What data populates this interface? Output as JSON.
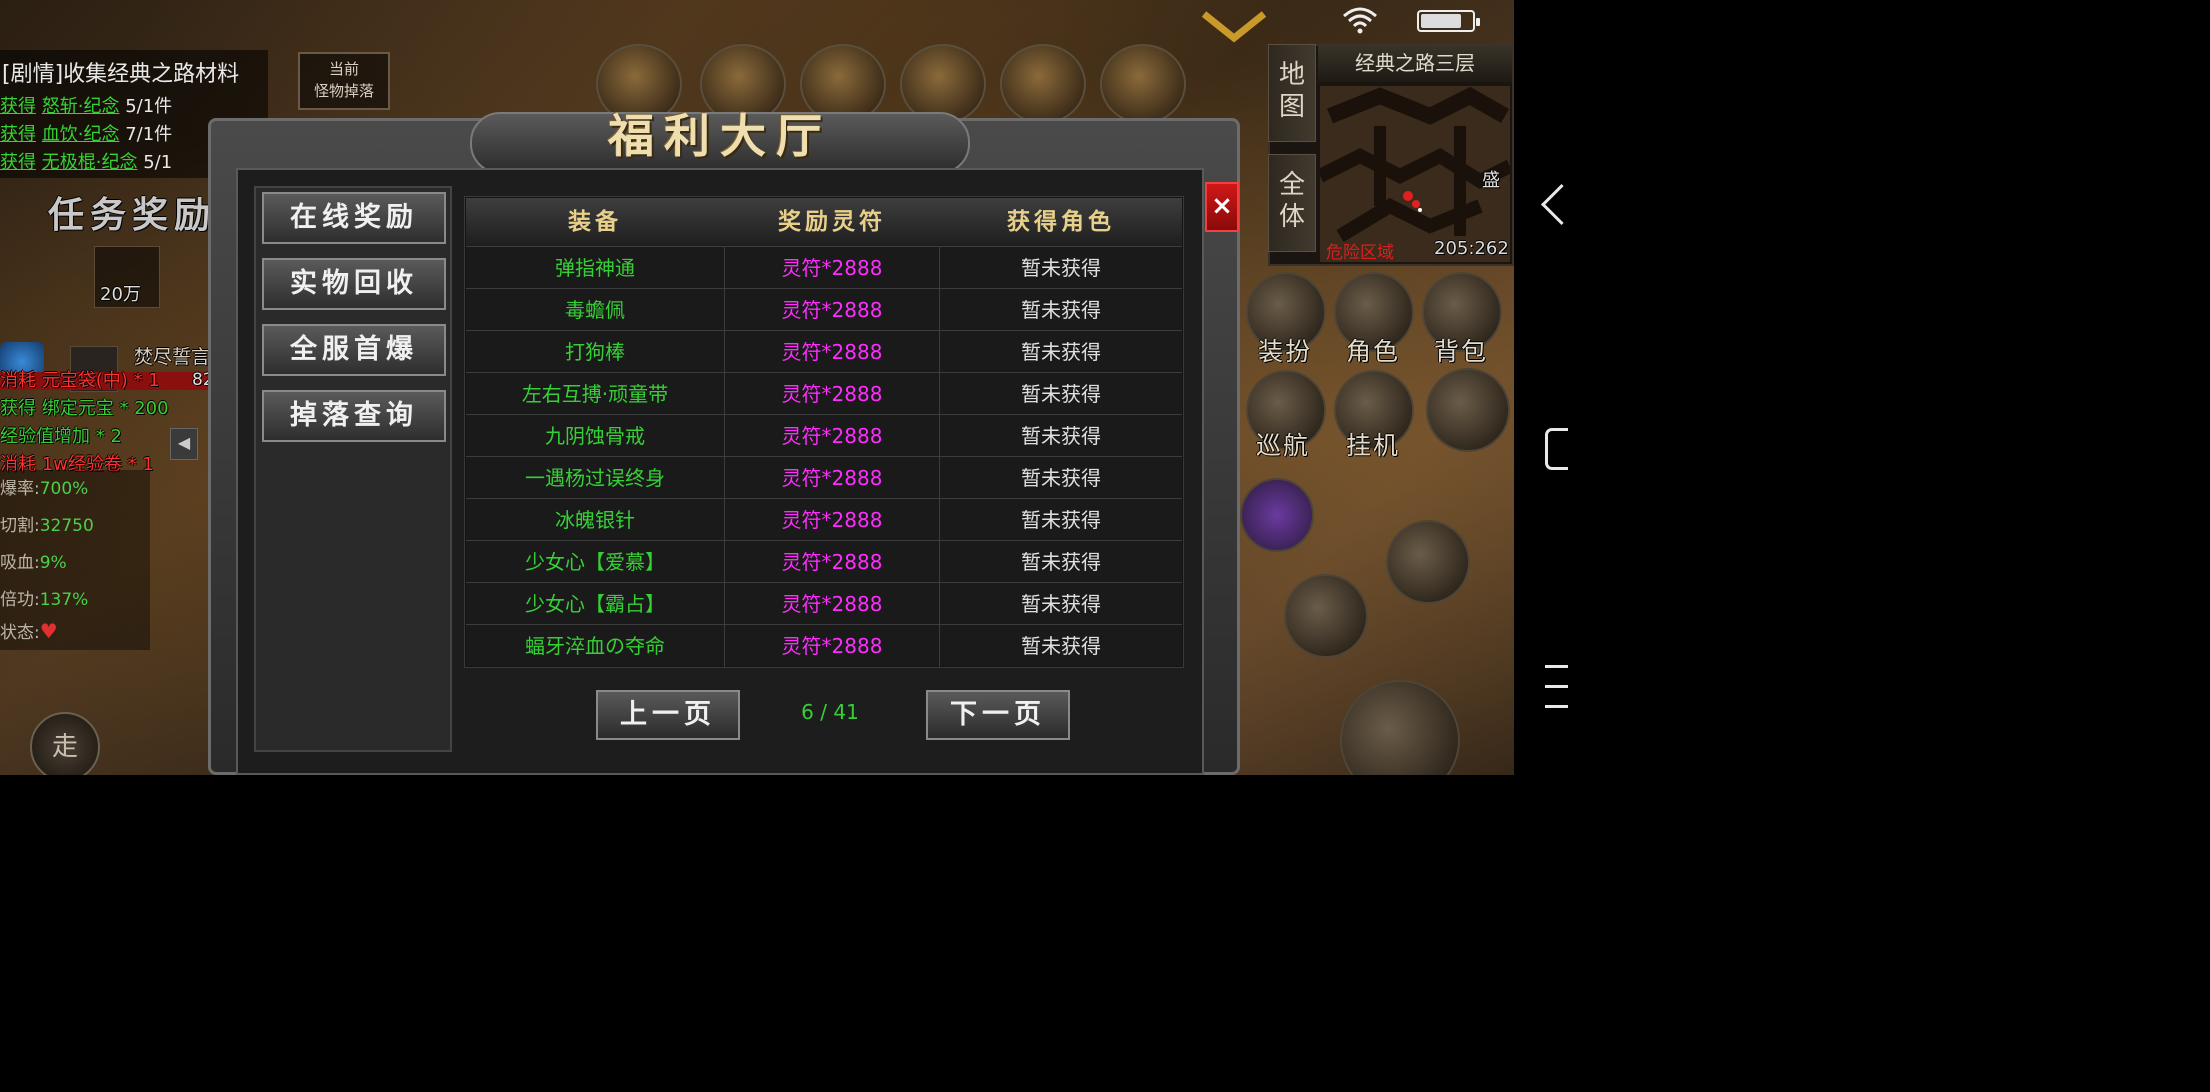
{
  "dialog": {
    "title": "福利大厅",
    "close_label": "×",
    "categories": [
      "在线奖励",
      "实物回收",
      "全服首爆",
      "掉落查询"
    ],
    "table": {
      "headers": [
        "装备",
        "奖励灵符",
        "获得角色"
      ],
      "rows": [
        {
          "item": "弹指神通",
          "reward": "灵符*2888",
          "owner": "暂未获得"
        },
        {
          "item": "毒蟾佩",
          "reward": "灵符*2888",
          "owner": "暂未获得"
        },
        {
          "item": "打狗棒",
          "reward": "灵符*2888",
          "owner": "暂未获得"
        },
        {
          "item": "左右互搏·顽童带",
          "reward": "灵符*2888",
          "owner": "暂未获得"
        },
        {
          "item": "九阴蚀骨戒",
          "reward": "灵符*2888",
          "owner": "暂未获得"
        },
        {
          "item": "一遇杨过误终身",
          "reward": "灵符*2888",
          "owner": "暂未获得"
        },
        {
          "item": "冰魄银针",
          "reward": "灵符*2888",
          "owner": "暂未获得"
        },
        {
          "item": "少女心【爱慕】",
          "reward": "灵符*2888",
          "owner": "暂未获得"
        },
        {
          "item": "少女心【霸占】",
          "reward": "灵符*2888",
          "owner": "暂未获得"
        },
        {
          "item": "蝠牙淬血の夺命",
          "reward": "灵符*2888",
          "owner": "暂未获得"
        }
      ]
    },
    "pager": {
      "prev_label": "上一页",
      "next_label": "下一页",
      "indicator": "6 / 41"
    }
  },
  "quest": {
    "title": "[剧情]收集经典之路材料",
    "items": [
      {
        "prefix": "获得",
        "name": "怒斩·纪念",
        "count": "5/1件"
      },
      {
        "prefix": "获得",
        "name": "血饮·纪念",
        "count": "7/1件"
      },
      {
        "prefix": "获得",
        "name": "无极棍·纪念",
        "count": "5/1"
      }
    ],
    "monster_drop_label": "当前\n怪物掉落",
    "reward_title": "任务奖励",
    "reward_amount": "20万"
  },
  "status_log": [
    {
      "text": "消耗 元宝袋(中) * 1",
      "color": "#ff3030"
    },
    {
      "text": "获得 绑定元宝 * 200",
      "color": "#36d036"
    },
    {
      "text": "经验值增加 * 2",
      "color": "#36d036"
    },
    {
      "text": "消耗 1w经验卷 * 1",
      "color": "#ff3030"
    }
  ],
  "party_member": {
    "name": "焚尽誓言",
    "hp": "82%"
  },
  "stats": [
    {
      "label": "爆率:",
      "value": "700%"
    },
    {
      "label": "切割:",
      "value": "32750"
    },
    {
      "label": "吸血:",
      "value": "9%"
    },
    {
      "label": "倍功:",
      "value": "137%"
    },
    {
      "label": "状态:",
      "value": ""
    }
  ],
  "walk_label": "走",
  "minimap": {
    "title": "经典之路三层",
    "tab_map": "地图",
    "tab_all": "全体",
    "coord": "205:262",
    "danger": "危险区域",
    "marker": "盛"
  },
  "skills": {
    "dress": "装扮",
    "role": "角色",
    "bag": "背包",
    "patrol": "巡航",
    "auto": "挂机"
  },
  "battery_level": 0.74
}
